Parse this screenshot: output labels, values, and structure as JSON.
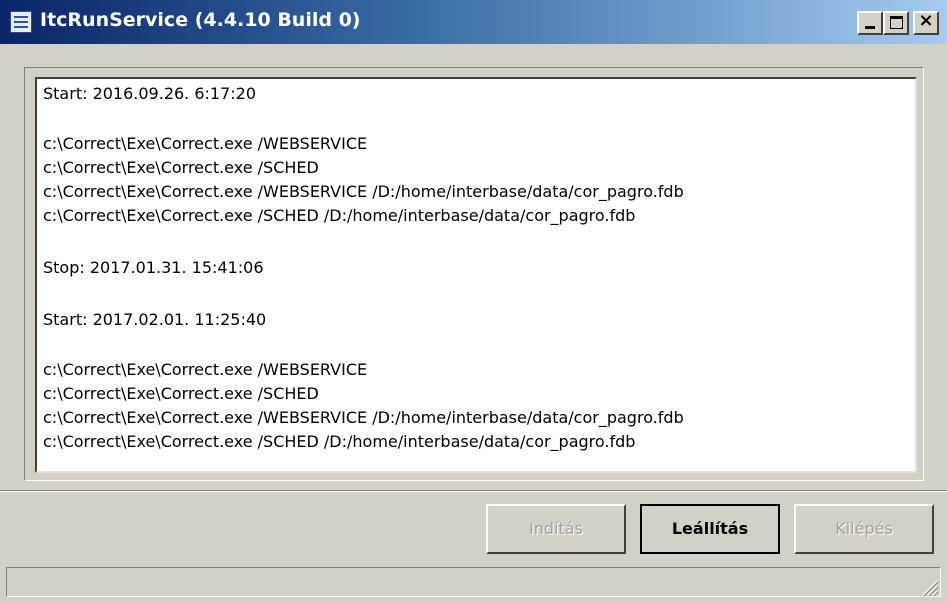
{
  "window": {
    "title": "ItcRunService (4.4.10 Build 0)"
  },
  "log": {
    "lines": [
      "Start: 2016.09.26. 6:17:20",
      "c:\\Correct\\Exe\\Correct.exe /WEBSERVICE",
      "c:\\Correct\\Exe\\Correct.exe /SCHED",
      "c:\\Correct\\Exe\\Correct.exe /WEBSERVICE /D:/home/interbase/data/cor_pagro.fdb",
      "c:\\Correct\\Exe\\Correct.exe /SCHED /D:/home/interbase/data/cor_pagro.fdb",
      "Stop: 2017.01.31. 15:41:06",
      "Start: 2017.02.01. 11:25:40",
      "c:\\Correct\\Exe\\Correct.exe /WEBSERVICE",
      "c:\\Correct\\Exe\\Correct.exe /SCHED",
      "c:\\Correct\\Exe\\Correct.exe /WEBSERVICE /D:/home/interbase/data/cor_pagro.fdb",
      "c:\\Correct\\Exe\\Correct.exe /SCHED /D:/home/interbase/data/cor_pagro.fdb"
    ]
  },
  "buttons": {
    "start_label": "Indítás",
    "stop_label": "Leállítás",
    "exit_label": "Kilépés"
  },
  "icons": {
    "app": "app-icon",
    "minimize": "minimize-icon",
    "maximize": "maximize-icon",
    "close": "close-icon",
    "grip": "resize-grip-icon"
  },
  "colors": {
    "titlebar_start": "#0a246a",
    "titlebar_end": "#a6caf0",
    "face": "#d4d0c8"
  }
}
